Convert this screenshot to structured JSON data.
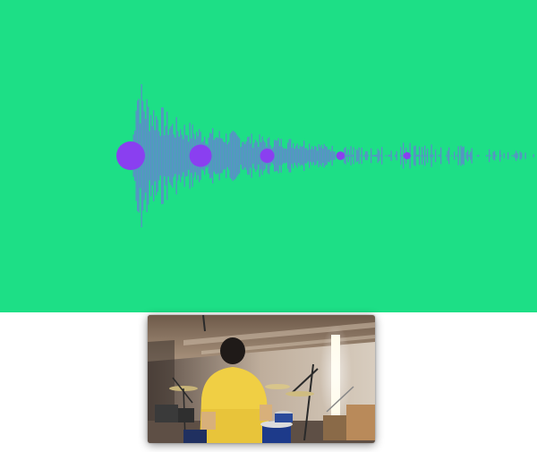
{
  "colors": {
    "background": "#1ddf86",
    "waveform": "#5b8fc8",
    "marker": "#8a3ff0",
    "lower_background": "#ffffff"
  },
  "waveform": {
    "envelope": [
      [
        0.0,
        0.0
      ],
      [
        0.01,
        1.0
      ],
      [
        0.04,
        0.7
      ],
      [
        0.1,
        0.45
      ],
      [
        0.18,
        0.33
      ],
      [
        0.26,
        0.28
      ],
      [
        0.34,
        0.22
      ],
      [
        0.42,
        0.2
      ],
      [
        0.48,
        0.13
      ],
      [
        0.55,
        0.08
      ],
      [
        0.65,
        0.12
      ],
      [
        0.75,
        0.1
      ],
      [
        0.85,
        0.08
      ],
      [
        0.95,
        0.05
      ],
      [
        1.0,
        0.02
      ]
    ]
  },
  "markers": [
    {
      "position": 0.0,
      "size": 1.0
    },
    {
      "position": 0.21,
      "size": 0.78
    },
    {
      "position": 0.41,
      "size": 0.5
    },
    {
      "position": 0.63,
      "size": 0.3
    },
    {
      "position": 0.83,
      "size": 0.25
    }
  ],
  "video": {
    "subject": "drummer-in-yellow-shirt"
  }
}
